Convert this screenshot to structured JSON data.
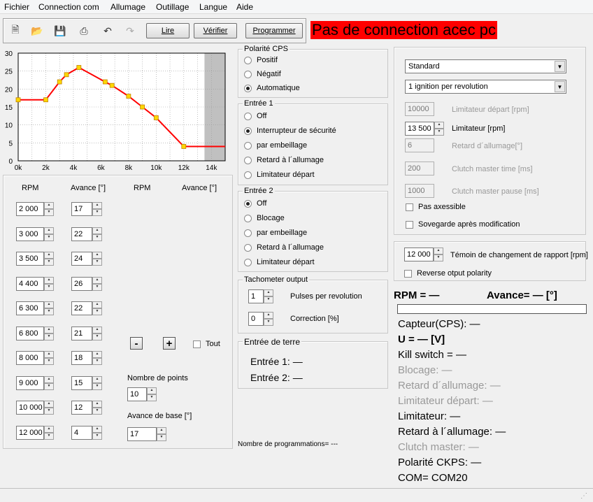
{
  "menu": [
    "Fichier",
    "Connection com",
    "Allumage",
    "Outillage",
    "Langue",
    "Aide"
  ],
  "toolbar": {
    "read_label": "Lire",
    "verify_label": "Vérifier",
    "program_label": "Programmer"
  },
  "banner": "Pas de connection acec pc",
  "chart_data": {
    "type": "line",
    "x": [
      0,
      2000,
      3000,
      3500,
      4400,
      6300,
      6800,
      8000,
      9000,
      10000,
      12000,
      15000
    ],
    "y": [
      17,
      17,
      22,
      24,
      26,
      22,
      21,
      18,
      15,
      12,
      4,
      4
    ],
    "xticks": [
      "0k",
      "2k",
      "4k",
      "6k",
      "8k",
      "10k",
      "12k",
      "14k"
    ],
    "yticks": [
      "0",
      "5",
      "10",
      "15",
      "20",
      "25",
      "30"
    ],
    "xlim": [
      0,
      15000
    ],
    "ylim": [
      0,
      30
    ],
    "shaded_from": 13500,
    "line_color": "#ff0000",
    "marker_color": "#ffd700",
    "grid": true
  },
  "table": {
    "headers": [
      "RPM",
      "Avance [°]",
      "RPM",
      "Avance [°]"
    ],
    "rows": [
      {
        "rpm": "2 000",
        "adv": "17"
      },
      {
        "rpm": "3 000",
        "adv": "22"
      },
      {
        "rpm": "3 500",
        "adv": "24"
      },
      {
        "rpm": "4 400",
        "adv": "26"
      },
      {
        "rpm": "6 300",
        "adv": "22"
      },
      {
        "rpm": "6 800",
        "adv": "21"
      },
      {
        "rpm": "8 000",
        "adv": "18"
      },
      {
        "rpm": "9 000",
        "adv": "15"
      },
      {
        "rpm": "10 000",
        "adv": "12"
      },
      {
        "rpm": "12 000",
        "adv": "4"
      }
    ],
    "minus": "-",
    "plus": "+",
    "all_label": "Tout",
    "points_label": "Nombre de points",
    "points_value": "10",
    "base_label": "Avance de base [°]",
    "base_value": "17"
  },
  "polarity": {
    "title": "Polarité CPS",
    "options": [
      "Positif",
      "Négatif",
      "Automatique"
    ],
    "selected": 2
  },
  "input1": {
    "title": "Entrée 1",
    "options": [
      "Off",
      "Interrupteur de sécurité",
      "par embeillage",
      "Retard à l´allumage",
      "Limitateur départ"
    ],
    "selected": 1
  },
  "input2": {
    "title": "Entrée 2",
    "options": [
      "Off",
      "Blocage",
      "par embeillage",
      "Retard à l´allumage",
      "Limitateur départ"
    ],
    "selected": 0
  },
  "tach": {
    "title": "Tachometer output",
    "pulses_value": "1",
    "pulses_label": "Pulses per revolution",
    "corr_value": "0",
    "corr_label": "Correction [%]"
  },
  "ground": {
    "title": "Entrée de terre",
    "in1": "Entrée 1: —",
    "in2": "Entrée 2: —"
  },
  "prog_count": "Nombre de programmations= ---",
  "settings": {
    "mode": "Standard",
    "ignition": "1 ignition per revolution",
    "start_limit_value": "10000",
    "start_limit_label": "Limitateur départ [rpm]",
    "limiter_value": "13 500",
    "limiter_label": "Limitateur [rpm]",
    "retard_value": "6",
    "retard_label": "Retard d´allumage[°]",
    "clutch_time_value": "200",
    "clutch_time_label": "Clutch master time [ms]",
    "clutch_pause_value": "1000",
    "clutch_pause_label": "Clutch master pause [ms]",
    "not_accessible": "Pas axessible",
    "save_after": "Sovegarde après modification"
  },
  "shift": {
    "value": "12 000",
    "label": "Témoin de changement de rapport [rpm]",
    "reverse": "Reverse otput polarity"
  },
  "status": {
    "rpm": "RPM = —",
    "advance": "Avance= — [°]",
    "sensor": "Capteur(CPS): —",
    "voltage": "U = — [V]",
    "kill": "Kill switch = —",
    "block": "Blocage: —",
    "retard": "Retard d´allumage: —",
    "start_limit": "Limitateur départ: —",
    "limiter": "Limitateur: —",
    "retard2": "Retard à l´allumage: —",
    "clutch": "Clutch master: —",
    "polarity": "Polarité CKPS: —",
    "com": "COM= COM20"
  }
}
